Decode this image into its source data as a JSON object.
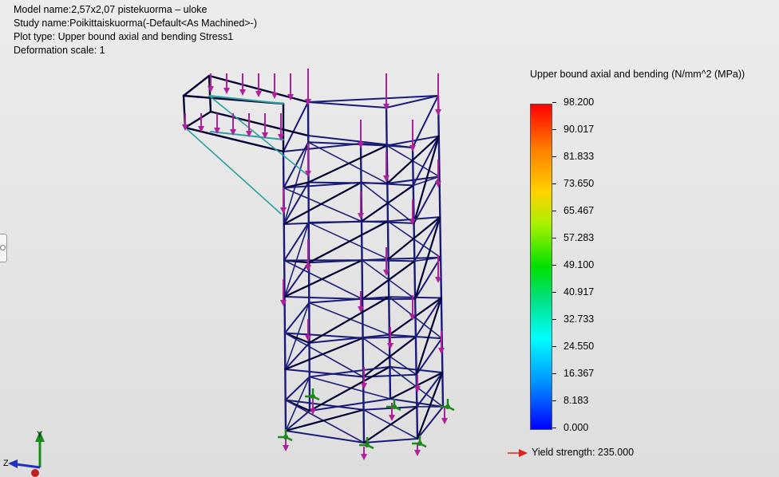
{
  "info": {
    "model_name": "Model name:2,57x2,07 pistekuorma – uloke",
    "study_name": "Study name:Poikittaiskuorma(-Default<As Machined>-)",
    "plot_type": "Plot type: Upper bound axial and bending Stress1",
    "deformation_scale": "Deformation scale: 1"
  },
  "legend": {
    "title": "Upper bound axial and bending (N/mm^2 (MPa))",
    "ticks": [
      "98.200",
      "90.017",
      "81.833",
      "73.650",
      "65.467",
      "57.283",
      "49.100",
      "40.917",
      "32.733",
      "24.550",
      "16.367",
      "8.183",
      "0.000"
    ],
    "min": 0.0,
    "max": 98.2,
    "yield_label": "Yield strength: 235.000",
    "yield_arrow_color": "#e02020"
  },
  "triad": {
    "y_label": "Y",
    "z_label": "Z"
  },
  "colors": {
    "frame": "#1a1a7a",
    "frame_dark": "#000033",
    "brace": "#20207a",
    "stress_mid": "#2aa0a0",
    "load_arrow": "#b0209a",
    "fixture": "#1a8a1a"
  },
  "icons": {
    "load": "downward-arrow-icon",
    "fixture": "fixed-support-icon",
    "handle": "side-panel-handle-icon"
  }
}
